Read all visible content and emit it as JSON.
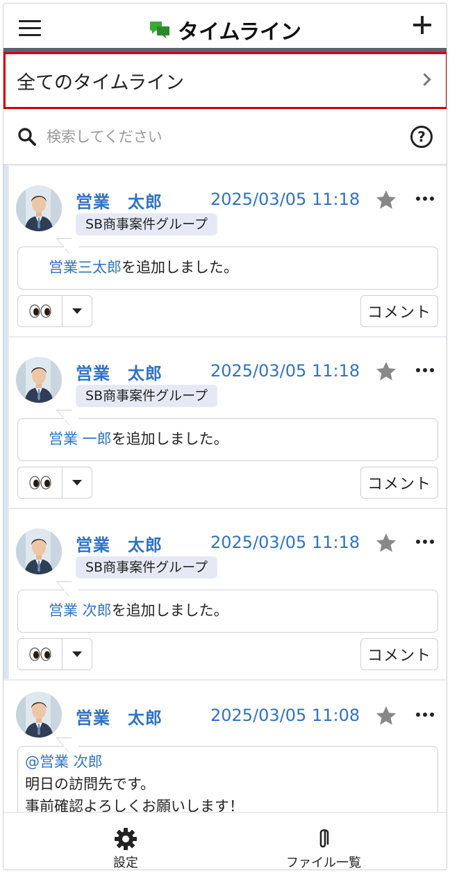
{
  "header": {
    "title": "タイムライン",
    "menu_icon": "hamburger-menu-icon",
    "logo_icon": "chat-bubbles-icon",
    "add_icon": "plus-icon"
  },
  "timeline_selector": {
    "label": "全てのタイムライン",
    "icon": "chevron-right-icon"
  },
  "search": {
    "placeholder": "検索してください",
    "value": "",
    "help_icon_text": "?"
  },
  "posts": [
    {
      "author": "営業　太郎",
      "timestamp": "2025/03/05 11:18",
      "group": "SB商事案件グループ",
      "mention": "営業三太郎",
      "body": "を追加しました。",
      "reaction": "👀",
      "comment_label": "コメント"
    },
    {
      "author": "営業　太郎",
      "timestamp": "2025/03/05 11:18",
      "group": "SB商事案件グループ",
      "mention": "営業 一郎",
      "body": "を追加しました。",
      "reaction": "👀",
      "comment_label": "コメント"
    },
    {
      "author": "営業　太郎",
      "timestamp": "2025/03/05 11:18",
      "group": "SB商事案件グループ",
      "mention": "営業 次郎",
      "body": "を追加しました。",
      "reaction": "👀",
      "comment_label": "コメント"
    },
    {
      "author": "営業　太郎",
      "timestamp": "2025/03/05 11:08",
      "mention": "@営業 次郎",
      "lines": [
        "明日の訪問先です。",
        "事前確認よろしくお願いします！"
      ]
    }
  ],
  "bottom_nav": {
    "settings_label": "設定",
    "files_label": "ファイル一覧"
  },
  "colors": {
    "accent_link": "#2f72c4",
    "selector_border": "#d20000",
    "header_bar": "#5c6170",
    "logo_green": "#3aa935"
  }
}
